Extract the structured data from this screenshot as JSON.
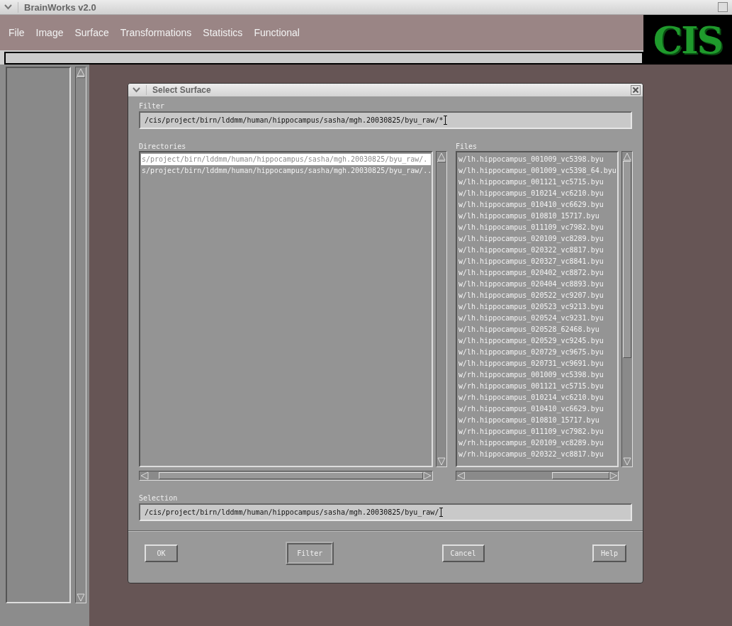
{
  "window": {
    "title": "BrainWorks v2.0"
  },
  "menu": [
    "File",
    "Image",
    "Surface",
    "Transformations",
    "Statistics",
    "Functional"
  ],
  "logo": "CIS",
  "dialog": {
    "title": "Select Surface",
    "filter": {
      "label": "Filter",
      "value": "/cis/project/birn/lddmm/human/hippocampus/sasha/mgh.20030825/byu_raw/*"
    },
    "directories": {
      "label": "Directories",
      "items": [
        {
          "text": "s/project/birn/lddmm/human/hippocampus/sasha/mgh.20030825/byu_raw/.",
          "selected": true
        },
        {
          "text": "s/project/birn/lddmm/human/hippocampus/sasha/mgh.20030825/byu_raw/..",
          "selected": false
        }
      ]
    },
    "files": {
      "label": "Files",
      "items": [
        {
          "text": "w/lh.hippocampus_001009_vc5398.byu",
          "selected": false
        },
        {
          "text": "w/lh.hippocampus_001009_vc5398_64.byu",
          "selected": false
        },
        {
          "text": "w/lh.hippocampus_001121_vc5715.byu",
          "selected": false
        },
        {
          "text": "w/lh.hippocampus_010214_vc6210.byu",
          "selected": false
        },
        {
          "text": "w/lh.hippocampus_010410_vc6629.byu",
          "selected": false
        },
        {
          "text": "w/lh.hippocampus_010810_15717.byu",
          "selected": false
        },
        {
          "text": "w/lh.hippocampus_011109_vc7982.byu",
          "selected": false
        },
        {
          "text": "w/lh.hippocampus_020109_vc8289.byu",
          "selected": false
        },
        {
          "text": "w/lh.hippocampus_020322_vc8817.byu",
          "selected": false
        },
        {
          "text": "w/lh.hippocampus_020327_vc8841.byu",
          "selected": false
        },
        {
          "text": "w/lh.hippocampus_020402_vc8872.byu",
          "selected": false
        },
        {
          "text": "w/lh.hippocampus_020404_vc8893.byu",
          "selected": false
        },
        {
          "text": "w/lh.hippocampus_020522_vc9207.byu",
          "selected": false
        },
        {
          "text": "w/lh.hippocampus_020523_vc9213.byu",
          "selected": false
        },
        {
          "text": "w/lh.hippocampus_020524_vc9231.byu",
          "selected": false
        },
        {
          "text": "w/lh.hippocampus_020528_62468.byu",
          "selected": false
        },
        {
          "text": "w/lh.hippocampus_020529_vc9245.byu",
          "selected": false
        },
        {
          "text": "w/lh.hippocampus_020729_vc9675.byu",
          "selected": false
        },
        {
          "text": "w/lh.hippocampus_020731_vc9691.byu",
          "selected": false
        },
        {
          "text": "w/rh.hippocampus_001009_vc5398.byu",
          "selected": false
        },
        {
          "text": "w/rh.hippocampus_001121_vc5715.byu",
          "selected": false
        },
        {
          "text": "w/rh.hippocampus_010214_vc6210.byu",
          "selected": false
        },
        {
          "text": "w/rh.hippocampus_010410_vc6629.byu",
          "selected": false
        },
        {
          "text": "w/rh.hippocampus_010810_15717.byu",
          "selected": false
        },
        {
          "text": "w/rh.hippocampus_011109_vc7982.byu",
          "selected": false
        },
        {
          "text": "w/rh.hippocampus_020109_vc8289.byu",
          "selected": false
        },
        {
          "text": "w/rh.hippocampus_020322_vc8817.byu",
          "selected": false
        }
      ]
    },
    "selection": {
      "label": "Selection",
      "value": "/cis/project/birn/lddmm/human/hippocampus/sasha/mgh.20030825/byu_raw/"
    },
    "buttons": [
      {
        "label": "OK",
        "default": false
      },
      {
        "label": "Filter",
        "default": true
      },
      {
        "label": "Cancel",
        "default": false
      },
      {
        "label": "Help",
        "default": false
      }
    ]
  }
}
